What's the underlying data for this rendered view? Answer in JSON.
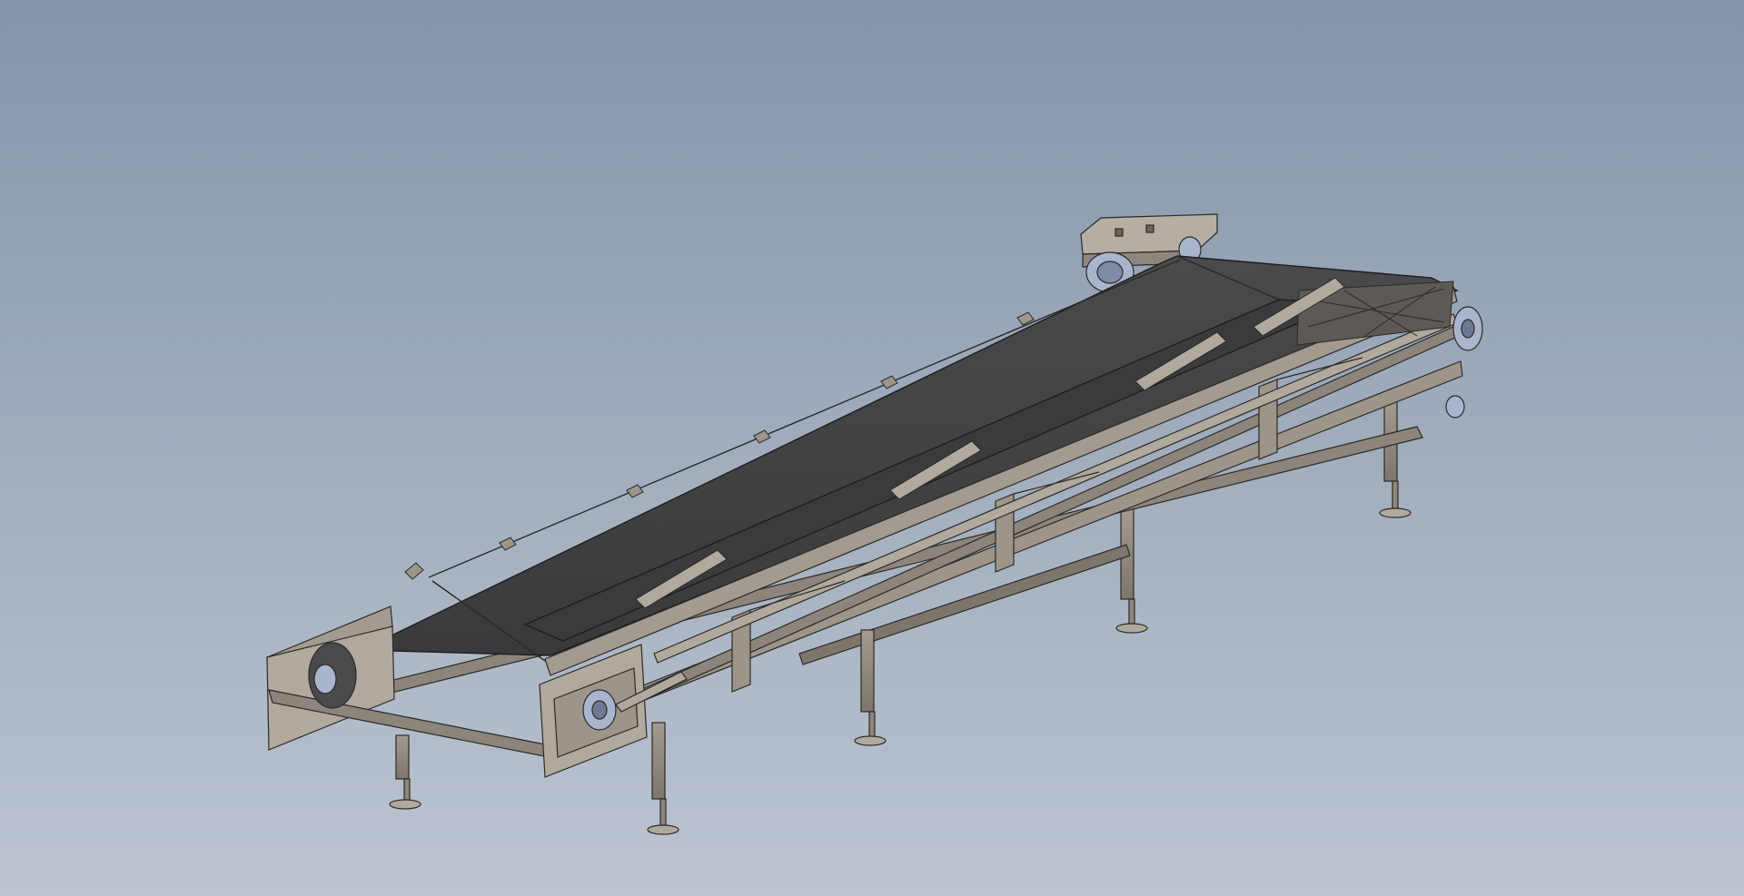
{
  "window": {
    "text": []
  },
  "viewport": {
    "background_top": "#8595ab",
    "background_bottom": "#bcc4d0",
    "model": "belt-conveyor-assembly",
    "display_style": "shaded-with-edges"
  },
  "colors": {
    "belt": "#434345",
    "belt_edge": "#1e1e20",
    "frame": "#8f877d",
    "frame_light": "#b0a99e",
    "frame_dark": "#6b645b",
    "bearing": "#a9b4cd",
    "outline": "#2b2a28"
  }
}
